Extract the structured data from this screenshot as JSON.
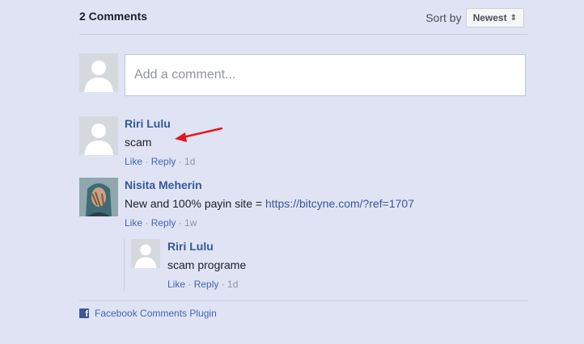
{
  "header": {
    "comment_count": "2 Comments",
    "sort_label": "Sort by",
    "sort_value": "Newest"
  },
  "composer": {
    "placeholder": "Add a comment..."
  },
  "comments": [
    {
      "author": "Riri Lulu",
      "text": "scam",
      "like": "Like",
      "reply": "Reply",
      "time": "1d"
    },
    {
      "author": "Nisita Meherin",
      "text_prefix": "New and 100% payin site = ",
      "link": "https://bitcyne.com/?ref=1707",
      "like": "Like",
      "reply": "Reply",
      "time": "1w",
      "replies": [
        {
          "author": "Riri Lulu",
          "text": "scam programe",
          "like": "Like",
          "reply": "Reply",
          "time": "1d"
        }
      ]
    }
  ],
  "footer": {
    "plugin_label": "Facebook Comments Plugin"
  },
  "colors": {
    "background": "#dfe3f3",
    "author": "#365899",
    "link": "#4267b2",
    "annotation_arrow": "#e8141c"
  },
  "icons": [
    "facebook-icon",
    "sort-caret-icon",
    "red-arrow-annotation"
  ]
}
